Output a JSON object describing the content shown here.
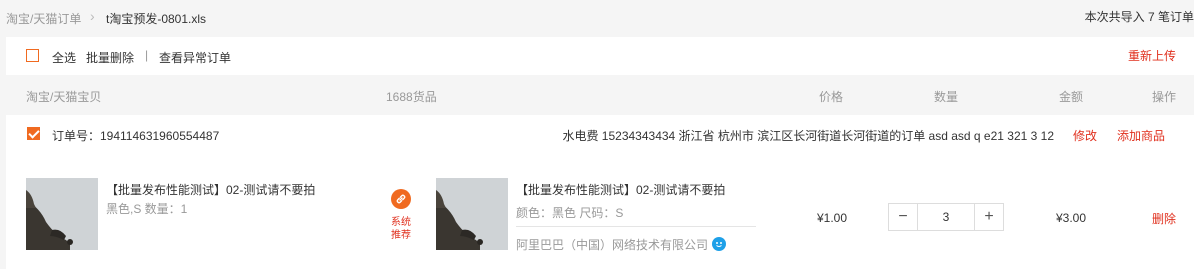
{
  "breadcrumb": {
    "root": "淘宝/天猫订单",
    "separator": "›",
    "file": "t淘宝预发-0801.xls"
  },
  "import_summary": "本次共导入 7 笔订单",
  "toolbar": {
    "select_all": "全选",
    "batch_delete": "批量删除",
    "divider": "|",
    "view_abnormal": "查看异常订单",
    "reupload": "重新上传"
  },
  "columns": {
    "taobao_item": "淘宝/天猫宝贝",
    "goods_1688": "1688货品",
    "price": "价格",
    "quantity": "数量",
    "amount": "金额",
    "action": "操作"
  },
  "order": {
    "number_text": "订单号：194114631960554487",
    "address": "水电费 15234343434 浙江省 杭州市 滨江区长河街道长河街道的订单 asd asd q e21 321 3 12",
    "edit": "修改",
    "add_product": "添加商品",
    "checked": true
  },
  "taobao_item": {
    "name": "【批量发布性能测试】02-测试请不要拍",
    "spec": "黑色,S 数量：1"
  },
  "recommend": {
    "line1": "系统",
    "line2": "推荐"
  },
  "goods_1688": {
    "name": "【批量发布性能测试】02-测试请不要拍",
    "spec": "颜色：黑色 尺码：S",
    "supplier": "阿里巴巴（中国）网络技术有限公司"
  },
  "line_item": {
    "price": "¥1.00",
    "quantity": "3",
    "minus": "−",
    "plus": "+",
    "amount": "¥3.00",
    "delete": "删除"
  },
  "colors": {
    "accent": "#f06a20",
    "link_red": "#e0301e",
    "wangwang_blue": "#1ea0e8"
  }
}
